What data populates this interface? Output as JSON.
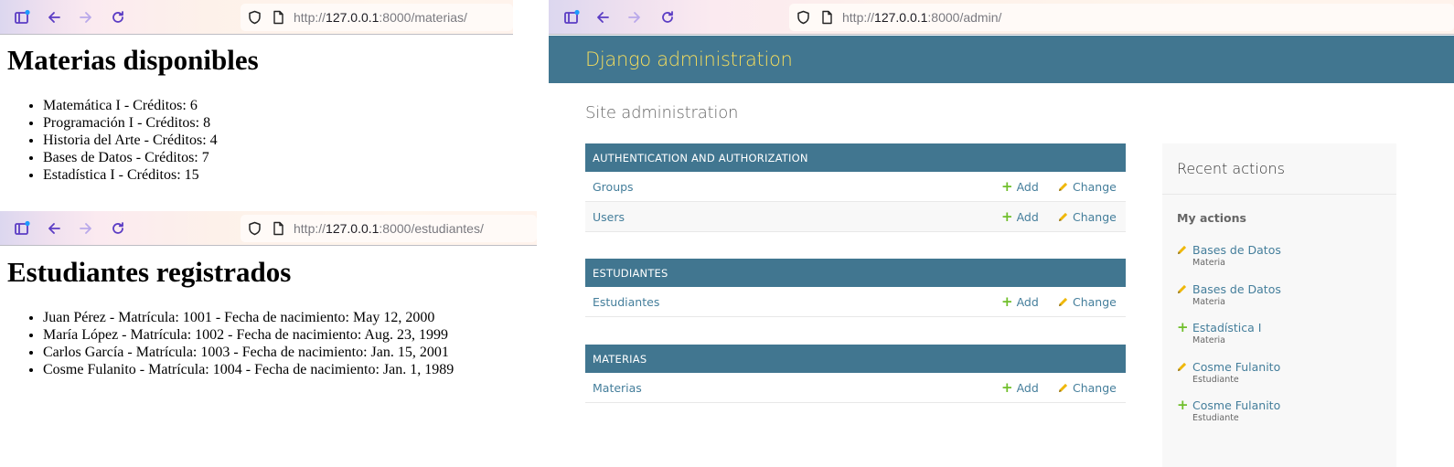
{
  "windows": {
    "materias": {
      "url_scheme": "http://",
      "url_host": "127.0.0.1",
      "url_rest": ":8000/materias/",
      "heading": "Materias disponibles",
      "items": [
        "Matemática I - Créditos: 6",
        "Programación I - Créditos: 8",
        "Historia del Arte - Créditos: 4",
        "Bases de Datos - Créditos: 7",
        "Estadística I - Créditos: 15"
      ]
    },
    "estudiantes": {
      "url_scheme": "http://",
      "url_host": "127.0.0.1",
      "url_rest": ":8000/estudiantes/",
      "heading": "Estudiantes registrados",
      "items": [
        "Juan Pérez - Matrícula: 1001 - Fecha de nacimiento: May 12, 2000",
        "María López - Matrícula: 1002 - Fecha de nacimiento: Aug. 23, 1999",
        "Carlos García - Matrícula: 1003 - Fecha de nacimiento: Jan. 15, 2001",
        "Cosme Fulanito - Matrícula: 1004 - Fecha de nacimiento: Jan. 1, 1989"
      ]
    },
    "admin": {
      "url_scheme": "http://",
      "url_host": "127.0.0.1",
      "url_rest": ":8000/admin/",
      "brand": "Django administration",
      "title": "Site administration",
      "modules": [
        {
          "caption": "AUTHENTICATION AND AUTHORIZATION",
          "models": [
            {
              "name": "Groups",
              "add": "Add",
              "change": "Change"
            },
            {
              "name": "Users",
              "add": "Add",
              "change": "Change"
            }
          ]
        },
        {
          "caption": "ESTUDIANTES",
          "models": [
            {
              "name": "Estudiantes",
              "add": "Add",
              "change": "Change"
            }
          ]
        },
        {
          "caption": "MATERIAS",
          "models": [
            {
              "name": "Materias",
              "add": "Add",
              "change": "Change"
            }
          ]
        }
      ],
      "recent": {
        "heading": "Recent actions",
        "subheading": "My actions",
        "actions": [
          {
            "kind": "change",
            "icon": "pencil-icon",
            "label": "Bases de Datos",
            "type": "Materia"
          },
          {
            "kind": "change",
            "icon": "pencil-icon",
            "label": "Bases de Datos",
            "type": "Materia"
          },
          {
            "kind": "add",
            "icon": "plus-icon",
            "label": "Estadística I",
            "type": "Materia"
          },
          {
            "kind": "change",
            "icon": "pencil-icon",
            "label": "Cosme Fulanito",
            "type": "Estudiante"
          },
          {
            "kind": "add",
            "icon": "plus-icon",
            "label": "Cosme Fulanito",
            "type": "Estudiante"
          }
        ]
      }
    }
  },
  "colors": {
    "admin_header": "#417690",
    "admin_brand": "#f5dd5d",
    "admin_link": "#447e9b",
    "add_green": "#70bf2b",
    "change_yellow": "#efb80b"
  }
}
